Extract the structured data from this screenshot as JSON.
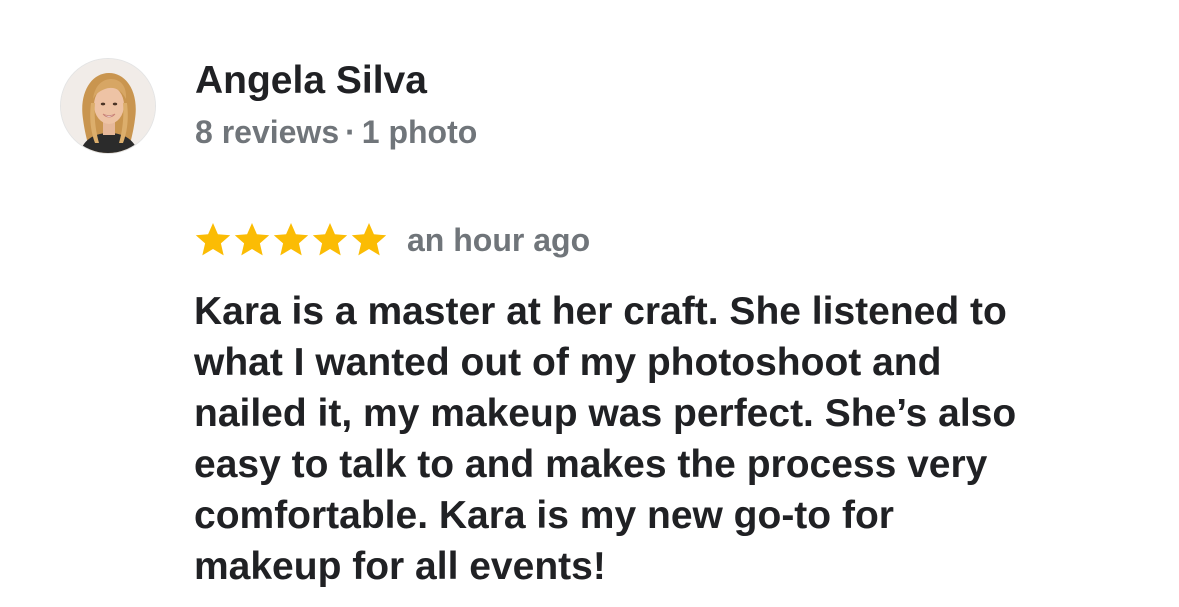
{
  "reviewer": {
    "name": "Angela Silva",
    "reviews_count": "8 reviews",
    "separator": "·",
    "photos_count": "1 photo",
    "avatar_icon": "profile-photo"
  },
  "review": {
    "rating": 5,
    "max_rating": 5,
    "star_color": "#fbbc04",
    "time": "an hour ago",
    "text_lines": [
      "Kara is a master at her craft. She listened to",
      "what I wanted out of my photoshoot and",
      "nailed it, my makeup was perfect. She’s also",
      "easy to talk to and makes the process very",
      "comfortable. Kara is my new go-to for",
      "makeup for all events!"
    ]
  },
  "colors": {
    "name_text": "#202124",
    "secondary_text": "#70757a"
  }
}
